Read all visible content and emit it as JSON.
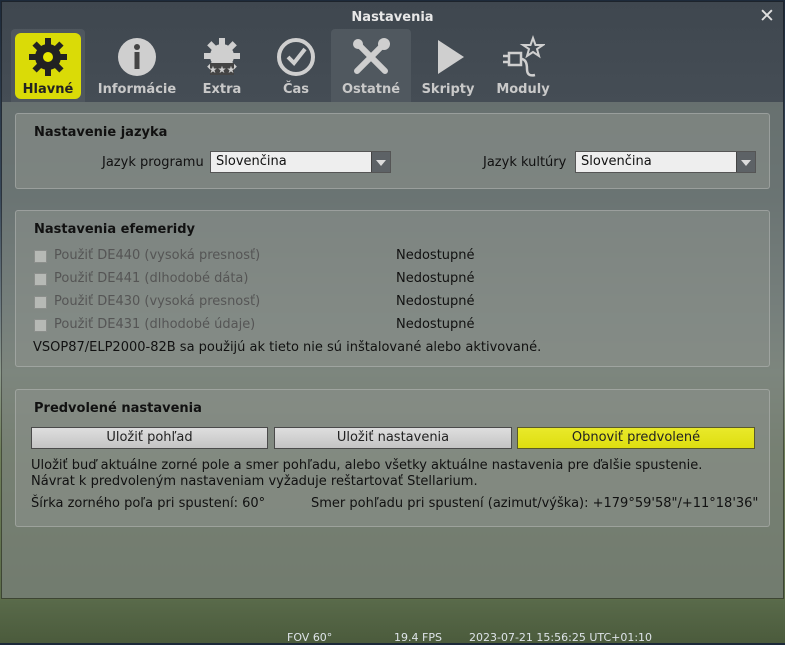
{
  "window": {
    "title": "Nastavenia"
  },
  "tabs": [
    {
      "label": "Hlavné",
      "icon": "gear-icon"
    },
    {
      "label": "Informácie",
      "icon": "info-icon"
    },
    {
      "label": "Extra",
      "icon": "extra-gear-stars-icon"
    },
    {
      "label": "Čas",
      "icon": "clock-icon"
    },
    {
      "label": "Ostatné",
      "icon": "tools-icon"
    },
    {
      "label": "Skripty",
      "icon": "play-icon"
    },
    {
      "label": "Moduly",
      "icon": "plugin-icon"
    }
  ],
  "language": {
    "title": "Nastavenie jazyka",
    "program_label": "Jazyk programu",
    "program_value": "Slovenčina",
    "culture_label": "Jazyk kultúry",
    "culture_value": "Slovenčina"
  },
  "ephemeris": {
    "title": "Nastavenia efemeridy",
    "items": [
      {
        "label": "Použiť DE440 (vysoká presnosť)",
        "status": "Nedostupné"
      },
      {
        "label": "Použiť DE441 (dlhodobé dáta)",
        "status": "Nedostupné"
      },
      {
        "label": "Použiť DE430 (vysoká presnosť)",
        "status": "Nedostupné"
      },
      {
        "label": "Použiť DE431 (dlhodobé údaje)",
        "status": "Nedostupné"
      }
    ],
    "note": "VSOP87/ELP2000-82B sa použijú ak tieto nie sú inštalované alebo aktivované."
  },
  "defaults": {
    "title": "Predvolené nastavenia",
    "save_view": "Uložiť pohľad",
    "save_settings": "Uložiť nastavenia",
    "restore_defaults": "Obnoviť predvolené",
    "info1": "Uložiť buď aktuálne zorné pole a smer pohľadu, alebo všetky aktuálne nastavenia pre ďalšie spustenie.",
    "info2": "Návrat k predvoleným nastaveniam vyžaduje reštartovať Stellarium.",
    "fov_startup": "Šírka zorného poľa pri spustení: 60°",
    "view_dir_startup": "Smer pohľadu pri spustení (azimut/výška): +179°59'58\"/+11°18'36\""
  },
  "statusbar": {
    "fov": "FOV 60°",
    "fps": "19.4 FPS",
    "datetime": "2023-07-21 15:56:25 UTC+01:10"
  },
  "colors": {
    "highlight": "#e6e600",
    "titlebar": "#434b53",
    "active_tab": "#4f575e"
  }
}
